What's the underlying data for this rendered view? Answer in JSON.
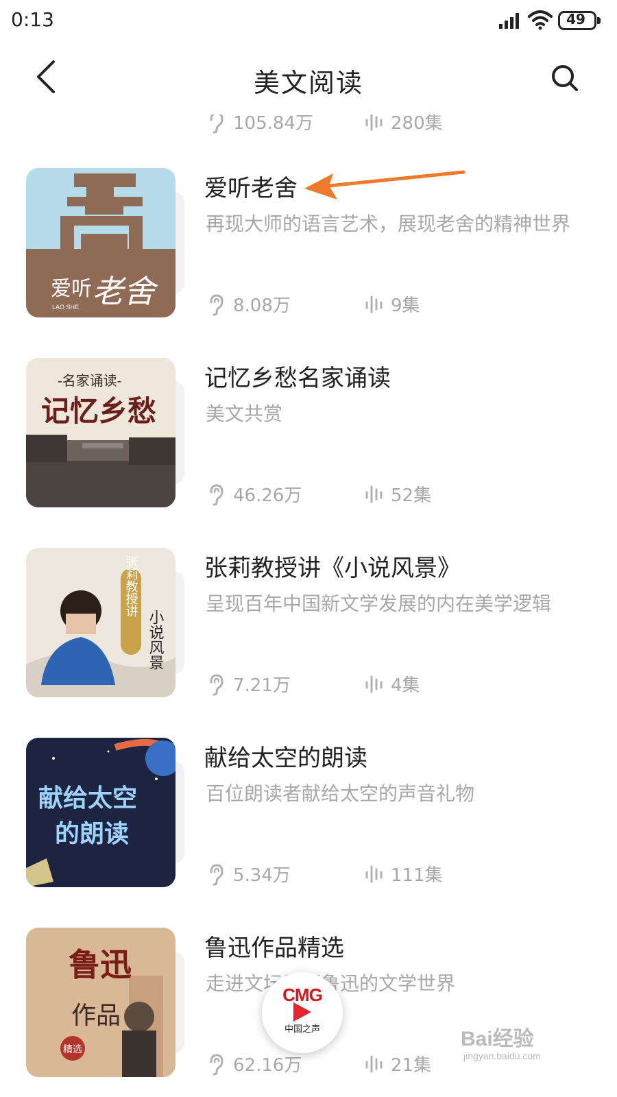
{
  "status_bar": {
    "time": "0:13",
    "battery": "49"
  },
  "header": {
    "title": "美文阅读"
  },
  "partial_item": {
    "plays": "105.84万",
    "episodes": "280集"
  },
  "items": [
    {
      "title": "爱听老舍",
      "description": "再现大师的语言艺术，展现老舍的精神世界",
      "plays": "8.08万",
      "episodes": "9集",
      "cover": {
        "line1": "爱听",
        "line2": "老舍",
        "line3": "LAO SHE"
      }
    },
    {
      "title": "记忆乡愁名家诵读",
      "description": "美文共赏",
      "plays": "46.26万",
      "episodes": "52集",
      "cover": {
        "line1": "-名家诵读-",
        "line2": "记忆乡愁"
      }
    },
    {
      "title": "张莉教授讲《小说风景》",
      "description": "呈现百年中国新文学发展的内在美学逻辑",
      "plays": "7.21万",
      "episodes": "4集",
      "cover": {
        "line1": "张莉教授讲",
        "line2": "小说风景"
      }
    },
    {
      "title": "献给太空的朗读",
      "description": "百位朗读者献给太空的声音礼物",
      "plays": "5.34万",
      "episodes": "111集",
      "cover": {
        "line1": "献给太空",
        "line2": "的朗读"
      }
    },
    {
      "title": "鲁迅作品精选",
      "description": "走进文坛巨匠鲁迅的文学世界",
      "plays": "62.16万",
      "episodes": "21集",
      "cover": {
        "line1": "鲁迅",
        "line2": "作品",
        "line3": "精选"
      }
    }
  ],
  "floating_player": {
    "logo": "CMG",
    "subtitle": "中国之声"
  },
  "watermark": {
    "main": "Bai经验",
    "sub": "jingyan.baidu.com"
  },
  "colors": {
    "annotation_arrow": "#f07a2c",
    "secondary_text": "#a8a8a8",
    "brand_red": "#d7131b"
  },
  "icons": {
    "back": "chevron-left-icon",
    "search": "search-icon",
    "plays": "ear-icon",
    "episodes": "sound-wave-icon"
  }
}
